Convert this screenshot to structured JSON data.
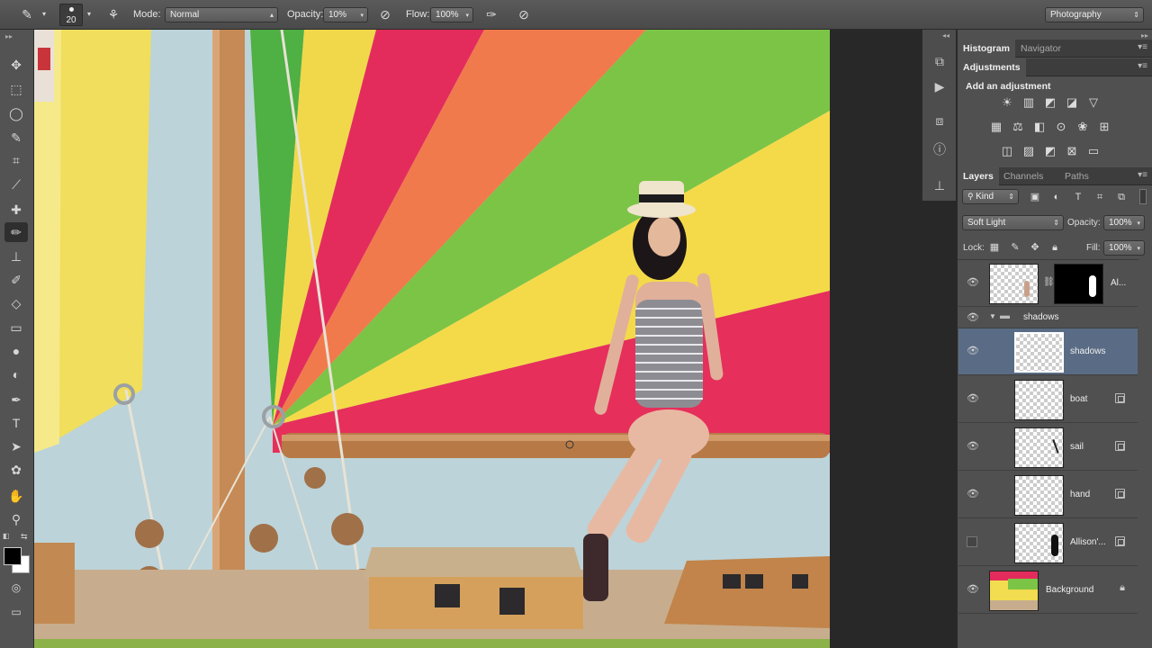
{
  "options_bar": {
    "brush_size": "20",
    "mode_label": "Mode:",
    "mode_value": "Normal",
    "opacity_label": "Opacity:",
    "opacity_value": "10%",
    "flow_label": "Flow:",
    "flow_value": "100%",
    "workspace": "Photography"
  },
  "toolbox": {
    "tools": [
      "move-icon",
      "marquee-icon",
      "lasso-icon",
      "quick-select-icon",
      "crop-icon",
      "eyedropper-icon",
      "healing-icon",
      "brush-icon",
      "clone-stamp-icon",
      "history-brush-icon",
      "eraser-icon",
      "gradient-icon",
      "blur-icon",
      "dodge-icon",
      "pen-icon",
      "type-icon",
      "path-select-icon",
      "shape-icon",
      "hand-icon",
      "zoom-icon"
    ],
    "active": "brush-icon",
    "foreground_color": "#000000",
    "background_color": "#ffffff"
  },
  "panel_top": {
    "tabs": [
      "Histogram",
      "Navigator"
    ]
  },
  "adjustments": {
    "tab": "Adjustments",
    "heading": "Add an adjustment",
    "icons_row1": [
      "brightness-icon",
      "levels-icon",
      "curves-icon",
      "exposure-icon",
      "vibrance-icon"
    ],
    "icons_row2": [
      "hue-saturation-icon",
      "color-balance-icon",
      "black-white-icon",
      "photo-filter-icon",
      "channel-mixer-icon",
      "color-lookup-icon"
    ],
    "icons_row3": [
      "invert-icon",
      "posterize-icon",
      "threshold-icon",
      "selective-color-icon",
      "gradient-map-icon"
    ]
  },
  "layers_panel": {
    "tabs": [
      "Layers",
      "Channels",
      "Paths"
    ],
    "filter_kind": "Kind",
    "blend_mode": "Soft Light",
    "opacity_label": "Opacity:",
    "opacity_value": "100%",
    "lock_label": "Lock:",
    "fill_label": "Fill:",
    "fill_value": "100%",
    "layers": [
      {
        "name": "Al...",
        "visible": true
      },
      {
        "name": "shadows",
        "visible": true,
        "group": true
      },
      {
        "name": "shadows",
        "visible": true,
        "selected": true
      },
      {
        "name": "boat",
        "visible": true
      },
      {
        "name": "sail",
        "visible": true
      },
      {
        "name": "hand",
        "visible": true
      },
      {
        "name": "Allison'...",
        "visible": false
      },
      {
        "name": "Background",
        "visible": true
      }
    ]
  }
}
